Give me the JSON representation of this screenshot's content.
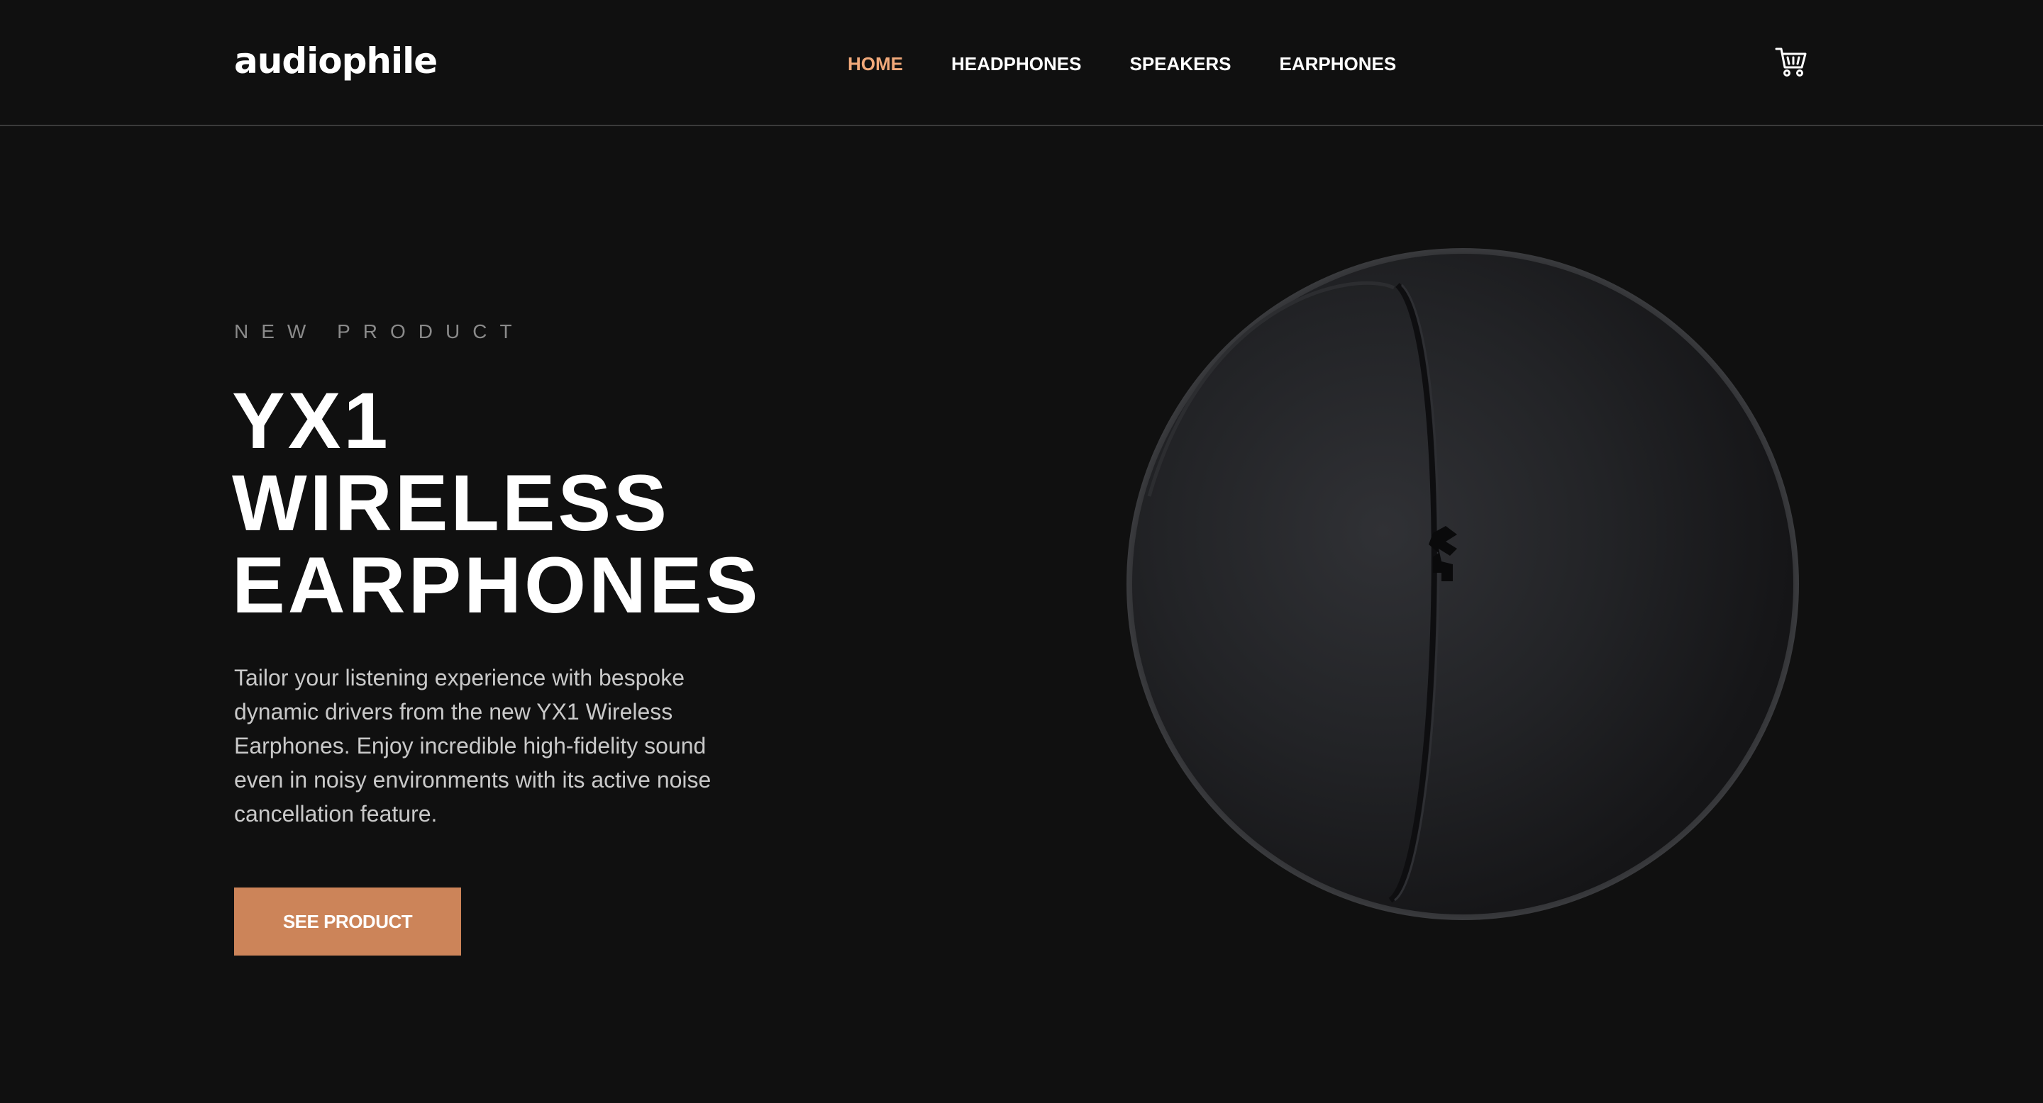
{
  "header": {
    "logo": "audiophile",
    "nav": [
      {
        "label": "HOME",
        "active": true
      },
      {
        "label": "HEADPHONES",
        "active": false
      },
      {
        "label": "SPEAKERS",
        "active": false
      },
      {
        "label": "EARPHONES",
        "active": false
      }
    ],
    "cart_icon": "cart-icon"
  },
  "hero": {
    "eyebrow": "NEW PRODUCT",
    "title_lines": [
      "YX1",
      "WIRELESS",
      "EARPHONES"
    ],
    "description": "Tailor your listening experience with bespoke dynamic drivers from the new YX1 Wireless Earphones. Enjoy incredible high-fidelity sound even in noisy environments with its active noise cancellation feature.",
    "cta_label": "SEE PRODUCT",
    "image": "earphones-case-image"
  },
  "colors": {
    "background": "#101010",
    "accent": "#cc8459",
    "nav_active": "#f1a97a",
    "text": "#ffffff",
    "muted": "#8a8a8a"
  }
}
